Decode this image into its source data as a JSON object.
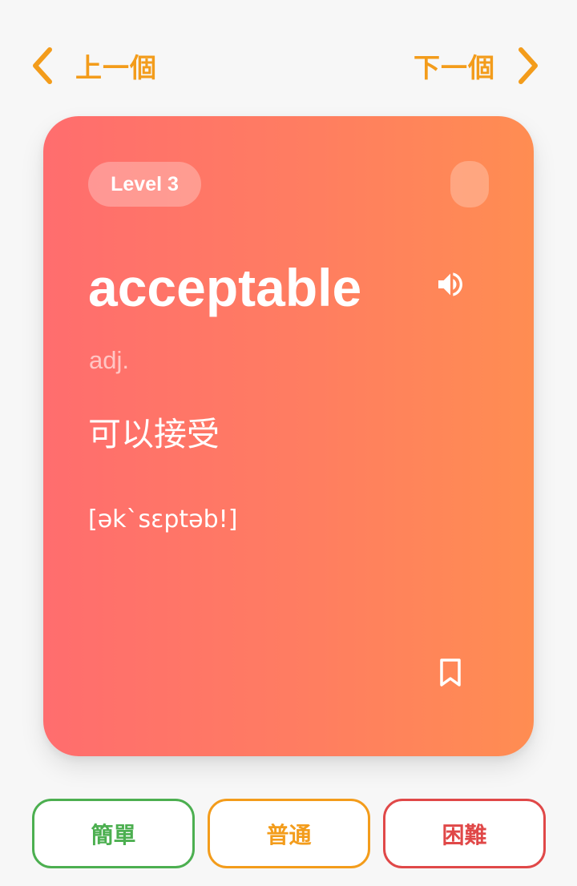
{
  "nav": {
    "prev_label": "上一個",
    "next_label": "下一個",
    "prev_icon": "chevron-left-icon",
    "next_icon": "chevron-right-icon"
  },
  "card": {
    "level": "Level 3",
    "word": "acceptable",
    "part_of_speech": "adj.",
    "meaning": "可以接受",
    "phonetic": "[əkˋsɛptəb!]",
    "speak_icon": "volume-icon",
    "bookmark_icon": "bookmark-icon"
  },
  "difficulty": {
    "easy_label": "簡單",
    "normal_label": "普通",
    "hard_label": "困難"
  },
  "colors": {
    "accent": "#f39c1b",
    "card_gradient_start": "#ff6d6e",
    "card_gradient_end": "#ff8d52",
    "easy": "#4caf50",
    "normal": "#f39c1b",
    "hard": "#e04848",
    "background": "#f7f7f7"
  }
}
